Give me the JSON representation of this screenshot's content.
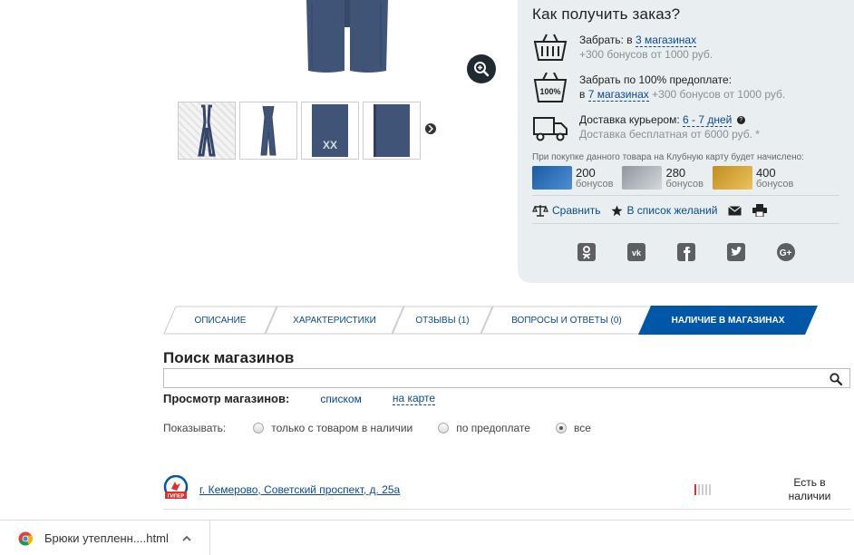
{
  "delivery": {
    "title": "Как получить заказ?",
    "pickup": {
      "label": "Забрать: в",
      "link": "3 магазинах",
      "note": "+300 бонусов от 1000 руб."
    },
    "prepaid": {
      "label": "Забрать по 100% предоплате:",
      "prefix": "в",
      "link": "7 магазинах",
      "note": "+300 бонусов от 1000 руб.",
      "badge": "100%"
    },
    "courier": {
      "label": "Доставка курьером:",
      "link": "6 - 7 дней",
      "help": "?",
      "note": "Доставка бесплатная от 6000 руб. *"
    },
    "bonus_note": "При покупке данного товара на Клубную карту будет начислено:",
    "bonus_cards": [
      {
        "value": "200",
        "label": "бонусов",
        "color": "#2c6fb5"
      },
      {
        "value": "280",
        "label": "бонусов",
        "color": "#a7adb3"
      },
      {
        "value": "400",
        "label": "бонусов",
        "color": "#d6a534"
      }
    ],
    "actions": {
      "compare": "Сравнить",
      "wishlist": "В список желаний"
    }
  },
  "tabs": [
    {
      "label": "ОПИСАНИЕ",
      "active": false
    },
    {
      "label": "ХАРАКТЕРИСТИКИ",
      "active": false
    },
    {
      "label": "ОТЗЫВЫ (1)",
      "active": false
    },
    {
      "label": "ВОПРОСЫ И ОТВЕТЫ (0)",
      "active": false
    },
    {
      "label": "НАЛИЧИЕ В МАГАЗИНАХ",
      "active": true
    }
  ],
  "shops": {
    "title": "Поиск магазинов",
    "search_value": "",
    "view_label": "Просмотр магазинов:",
    "view_list": "списком",
    "view_map": "на карте",
    "filter_label": "Показывать:",
    "filters": [
      {
        "label": "только с товаром в наличии",
        "checked": false
      },
      {
        "label": "по предоплате",
        "checked": false
      },
      {
        "label": "все",
        "checked": true
      }
    ]
  },
  "store": {
    "logo_text": "ГИПЕР",
    "address": "г. Кемерово, Советский проспект, д. 25а",
    "stock_level": 0.2,
    "stock_text_line1": "Есть в",
    "stock_text_line2": "наличии"
  },
  "download": {
    "file_name": "Брюки утепленн....html"
  },
  "colors": {
    "accent": "#0a4a8c",
    "tab_active": "#0057a8",
    "panel_bg": "#e9eef1"
  }
}
